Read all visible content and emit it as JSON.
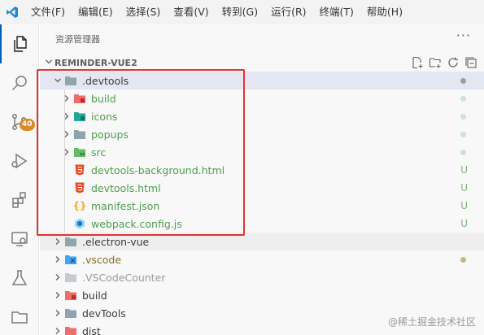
{
  "menu": [
    "文件(F)",
    "编辑(E)",
    "选择(S)",
    "查看(V)",
    "转到(G)",
    "运行(R)",
    "终端(T)",
    "帮助(H)"
  ],
  "activity_bar": {
    "source_control_badge": "40"
  },
  "explorer": {
    "title": "资源管理器",
    "more": "···",
    "section_title": "REMINDER-VUE2"
  },
  "tree": [
    {
      "label": ".devtools",
      "status_dot": true
    },
    {
      "label": "build"
    },
    {
      "label": "icons"
    },
    {
      "label": "popups"
    },
    {
      "label": "src"
    },
    {
      "label": "devtools-background.html",
      "status": "U"
    },
    {
      "label": "devtools.html",
      "status": "U"
    },
    {
      "label": "manifest.json",
      "status": "U"
    },
    {
      "label": "webpack.config.js",
      "status": "U"
    },
    {
      "label": ".electron-vue"
    },
    {
      "label": ".vscode",
      "status_dot": true
    },
    {
      "label": ".VSCodeCounter"
    },
    {
      "label": "build"
    },
    {
      "label": "devTools"
    },
    {
      "label": "dist"
    }
  ],
  "colors": {
    "accent": "#005fb8",
    "untracked_green": "#4f9d4f",
    "highlight_red": "#e23434",
    "badge_orange": "#d98a2b"
  },
  "watermark": "@稀土掘金技术社区"
}
